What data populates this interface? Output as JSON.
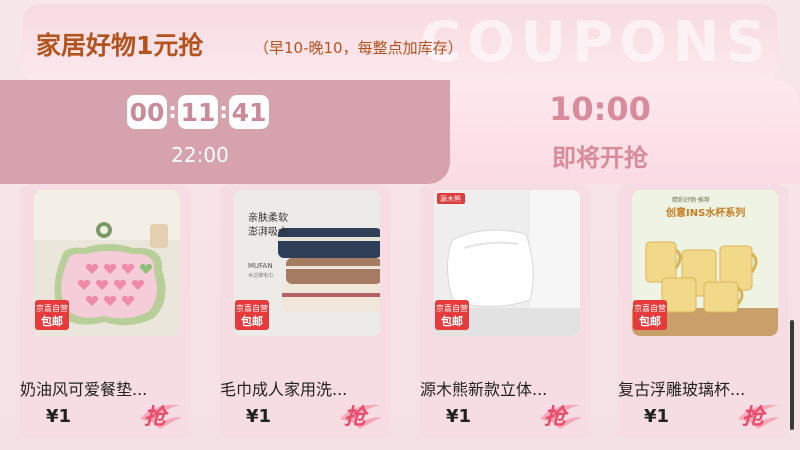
{
  "banner": {
    "title": "家居好物1元抢",
    "subtitle": "（早10-晚10，每整点加库存）",
    "watermark": "COUPONS"
  },
  "sessions": {
    "active": {
      "countdown": [
        "00",
        "11",
        "41"
      ],
      "time": "22:00"
    },
    "next": {
      "time": "10:00",
      "label": "即将开抢"
    }
  },
  "badge": {
    "brand": "京喜自营",
    "shipping": "包邮"
  },
  "grab_label": "抢",
  "products": [
    {
      "name": "奶油风可爱餐垫...",
      "price": "¥1"
    },
    {
      "name": "毛巾成人家用洗...",
      "price": "¥1",
      "image_text": [
        "亲肤柔软",
        "澎湃吸水",
        "MUFAN",
        "木泛棉毛巾"
      ]
    },
    {
      "name": "源木熊新款立体...",
      "price": "¥1",
      "image_text": [
        "源木熊"
      ]
    },
    {
      "name": "复古浮雕玻璃杯...",
      "price": "¥1",
      "image_text": [
        "精彩好物·推荐",
        "创意INS水杯系列"
      ]
    }
  ],
  "colors": {
    "accent": "#b3531e",
    "tab_active": "#d6a2ad",
    "tab_text": "#d88b9a",
    "badge": "#e83a3a",
    "grab": "#ea4b6b"
  }
}
